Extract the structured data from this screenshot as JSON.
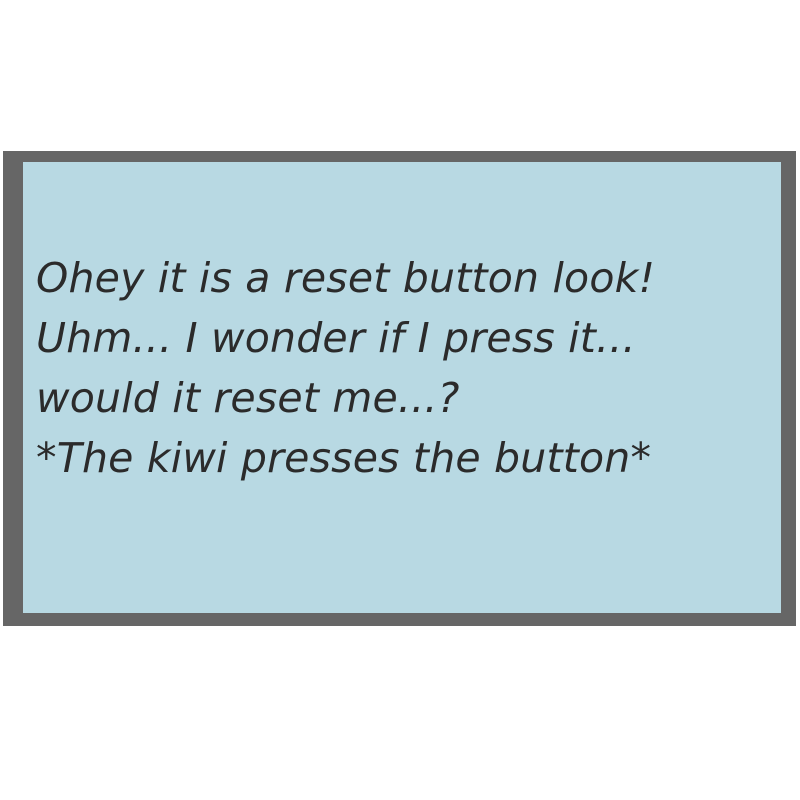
{
  "dialog": {
    "lines": [
      "Ohey it is a reset button look!",
      "Uhm... I wonder if I press it...",
      "would it reset me...?",
      "*The kiwi presses the button*"
    ]
  },
  "colors": {
    "background": "#ffffff",
    "frame": "#666666",
    "panel": "#b8d9e3",
    "text": "#2b2b2b"
  }
}
